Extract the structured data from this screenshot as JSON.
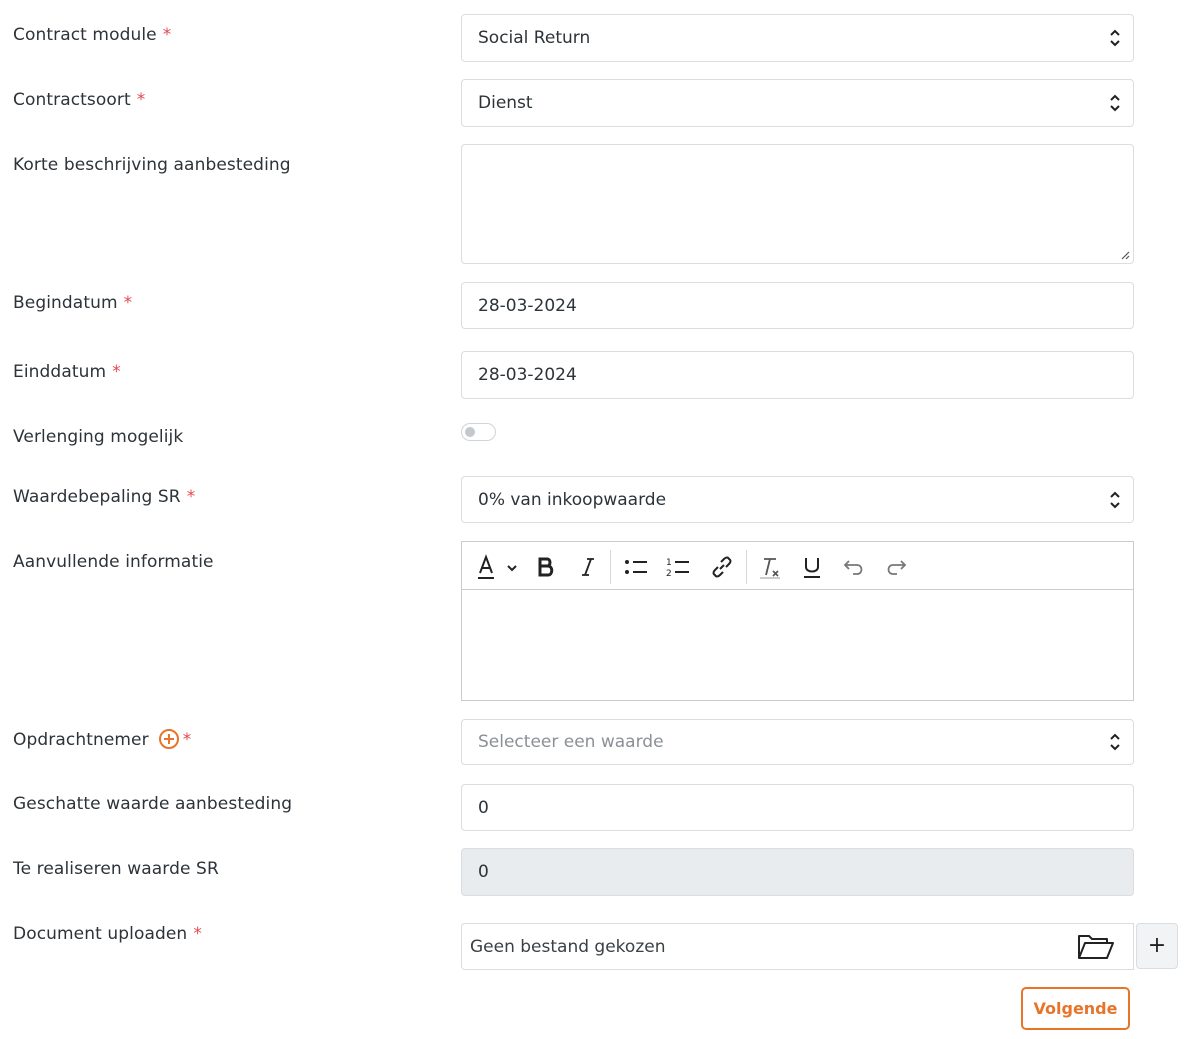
{
  "form": {
    "contract_module": {
      "label": "Contract module",
      "required": "*",
      "value": "Social Return"
    },
    "contractsoort": {
      "label": "Contractsoort",
      "required": "*",
      "value": "Dienst"
    },
    "korte_beschrijving": {
      "label": "Korte beschrijving aanbesteding",
      "value": ""
    },
    "begindatum": {
      "label": "Begindatum",
      "required": "*",
      "value": "28-03-2024"
    },
    "einddatum": {
      "label": "Einddatum",
      "required": "*",
      "value": "28-03-2024"
    },
    "verlenging": {
      "label": "Verlenging mogelijk",
      "state": "off"
    },
    "waardebepaling": {
      "label": "Waardebepaling SR",
      "required": "*",
      "value": "0% van inkoopwaarde"
    },
    "aanvullende_informatie": {
      "label": "Aanvullende informatie",
      "value": ""
    },
    "opdrachtnemer": {
      "label": "Opdrachtnemer",
      "required": "*",
      "placeholder": "Selecteer een waarde"
    },
    "geschatte_waarde": {
      "label": "Geschatte waarde aanbesteding",
      "value": "0"
    },
    "te_realiseren": {
      "label": "Te realiseren waarde SR",
      "value": "0"
    },
    "document": {
      "label": "Document uploaden",
      "required": "*",
      "file_text": "Geen bestand gekozen",
      "add_label": "+"
    }
  },
  "editor_toolbar": [
    "font-color-icon",
    "bold-icon",
    "italic-icon",
    "bullet-list-icon",
    "numbered-list-icon",
    "link-icon",
    "clear-format-icon",
    "underline-icon",
    "undo-icon",
    "redo-icon"
  ],
  "actions": {
    "next_label": "Volgende"
  },
  "colors": {
    "accent": "#e8742a",
    "required": "#e5484d",
    "border": "#dadde1",
    "disabled_bg": "#e9ecef"
  }
}
